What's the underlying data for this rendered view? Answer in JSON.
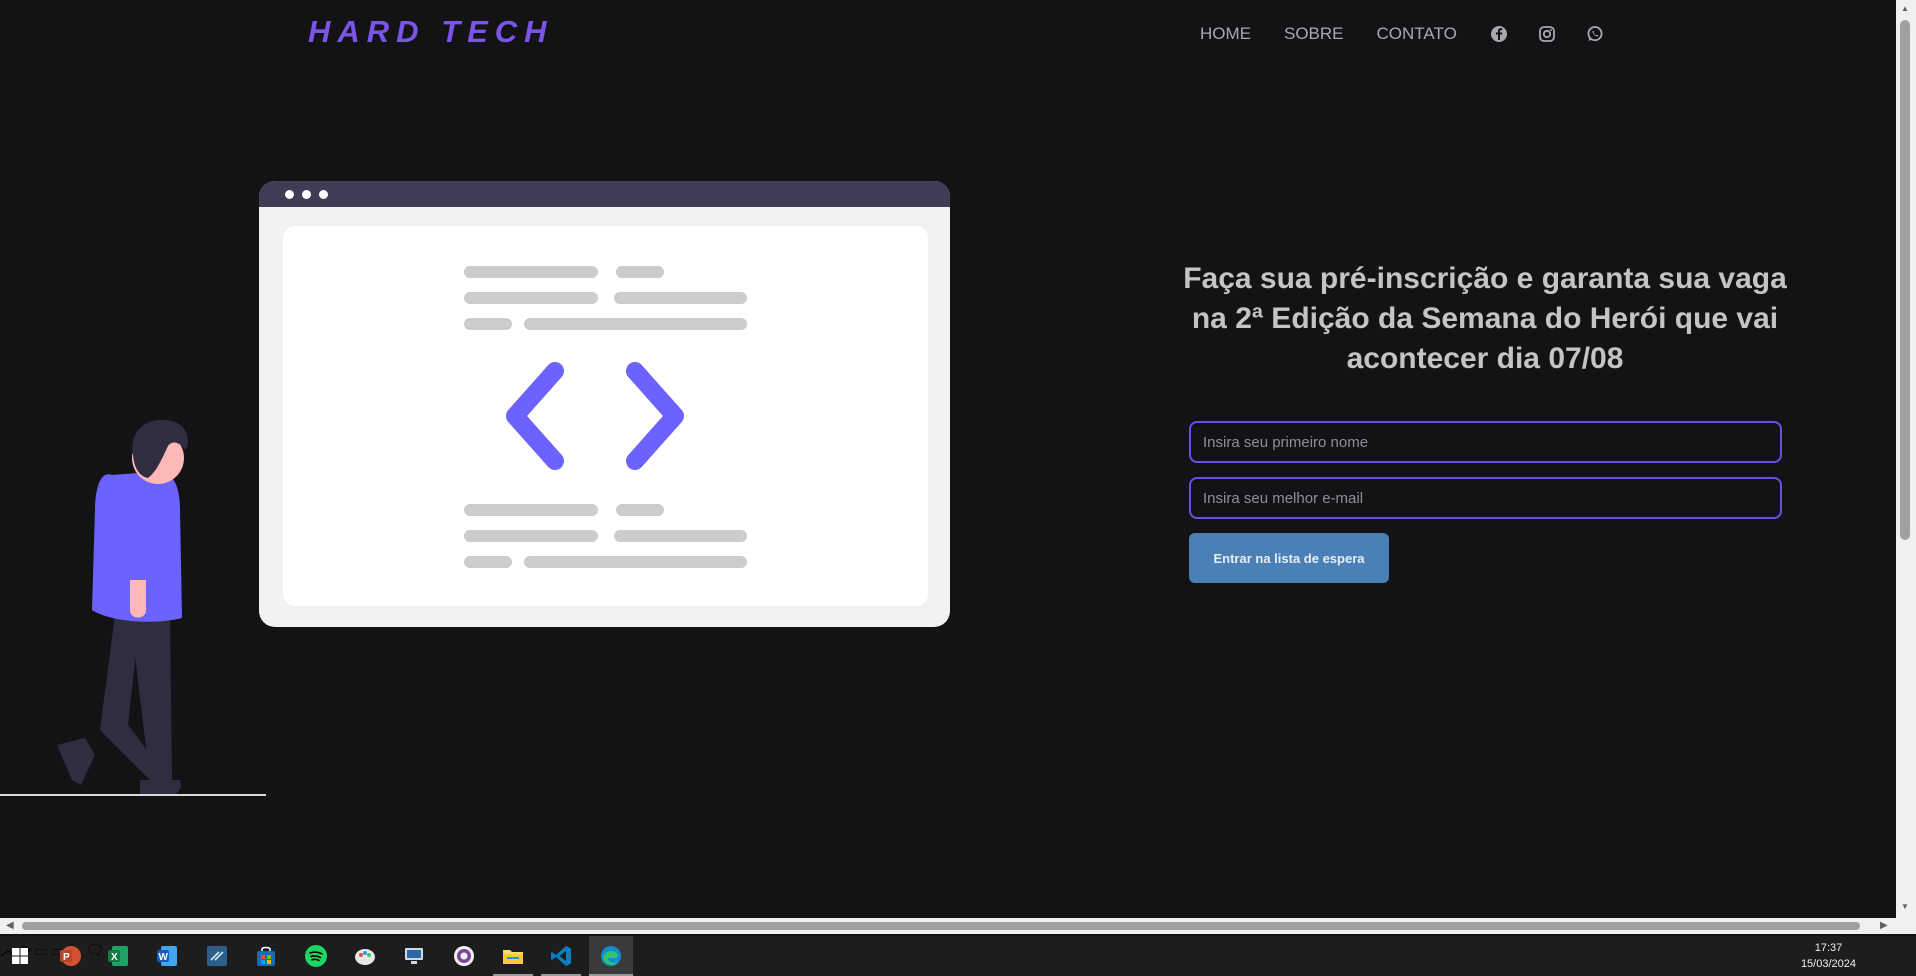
{
  "header": {
    "logo": "HARD TECH",
    "nav": [
      "HOME",
      "SOBRE",
      "CONTATO"
    ],
    "social_icons": [
      "facebook-icon",
      "instagram-icon",
      "whatsapp-icon"
    ]
  },
  "hero": {
    "headline": "Faça sua pré-inscrição e garanta sua vaga na 2ª Edição da Semana do Herói que vai acontecer dia 07/08",
    "name_placeholder": "Insira seu primeiro nome",
    "email_placeholder": "Insira seu melhor e-mail",
    "button_label": "Entrar na lista de espera"
  },
  "colors": {
    "background": "#131316",
    "accent": "#7b55e8",
    "button": "#4a80b6"
  },
  "taskbar": {
    "apps": [
      "windows-start-icon",
      "powerpoint-icon",
      "excel-icon",
      "word-icon",
      "terminal-icon",
      "store-icon",
      "spotify-icon",
      "paint-icon",
      "network-app-icon",
      "tor-browser-icon",
      "file-explorer-icon",
      "vscode-icon",
      "edge-icon"
    ],
    "time": "17:37",
    "date": "15/03/2024"
  }
}
